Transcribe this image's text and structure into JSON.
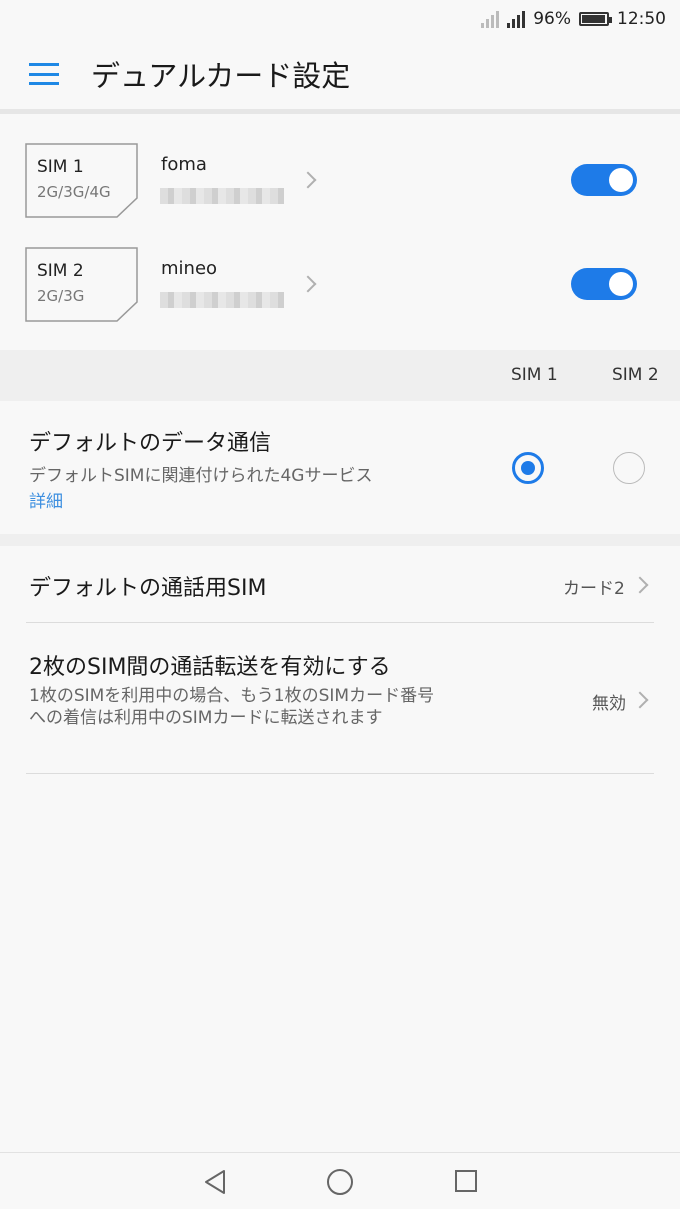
{
  "status_bar": {
    "battery": "96%",
    "time": "12:50",
    "signal_icons": [
      "signal-off-icon",
      "signal-icon"
    ],
    "battery_level": 0.96
  },
  "app_bar": {
    "title": "デュアルカード設定",
    "menu_icon": "menu-icon"
  },
  "sims": [
    {
      "name": "SIM 1",
      "tech": "2G/3G/4G",
      "carrier": "foma",
      "enabled": true
    },
    {
      "name": "SIM 2",
      "tech": "2G/3G",
      "carrier": "mineo",
      "enabled": true
    }
  ],
  "sim_columns": {
    "sim1": "SIM 1",
    "sim2": "SIM 2"
  },
  "default_data": {
    "title": "デフォルトのデータ通信",
    "subtitle": "デフォルトSIMに関連付けられた4Gサービス",
    "link": "詳細",
    "selected": "SIM 1"
  },
  "default_call": {
    "title": "デフォルトの通話用SIM",
    "value": "カード2"
  },
  "call_forward": {
    "title": "2枚のSIM間の通話転送を有効にする",
    "subtitle": "1枚のSIMを利用中の場合、もう1枚のSIMカード番号への着信は利用中のSIMカードに転送されます",
    "value": "無効"
  },
  "colors": {
    "accent": "#1e7be8",
    "link": "#3d8fe0"
  }
}
